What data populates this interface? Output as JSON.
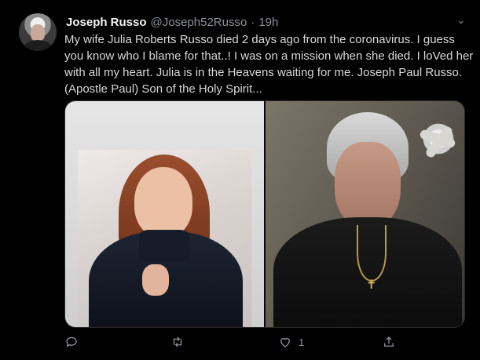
{
  "tweet": {
    "display_name": "Joseph Russo",
    "handle": "@Joseph52Russo",
    "separator": "·",
    "time": "19h",
    "text": "My wife Julia Roberts Russo died 2 days ago from the coronavirus. I guess you know who I blame for that..! I was on a mission when she died. I loVed her with all my heart. Julia is in the Heavens waiting for me. Joseph Paul Russo. (Apostle Paul) Son of the Holy Spirit...",
    "media": [
      {
        "alt": "Portrait of a woman with auburn hair in a dark turtleneck sweater"
      },
      {
        "alt": "Selfie of a man with gray hair wearing a dark jacket and a cross necklace"
      }
    ],
    "actions": {
      "reply_count": "",
      "retweet_count": "",
      "like_count": "1",
      "share_count": ""
    }
  },
  "icons": [
    "caret-down-icon",
    "reply-icon",
    "retweet-icon",
    "like-icon",
    "share-icon"
  ],
  "colors": {
    "background": "#000000",
    "text": "#d9d9d9",
    "muted": "#8a9298"
  }
}
